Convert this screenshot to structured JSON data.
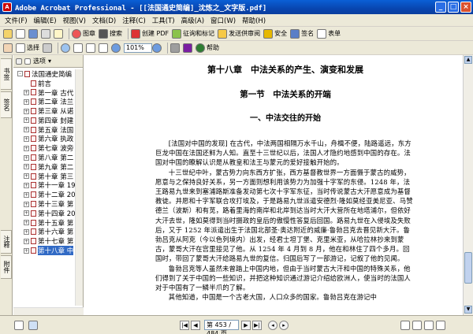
{
  "window": {
    "title": "Adobe Acrobat Professional - [[法国通史简编]_沈炼之_文字版.pdf]",
    "minimize": "_",
    "maximize": "□",
    "close": "×"
  },
  "menu": [
    "文件(F)",
    "编辑(E)",
    "视图(V)",
    "文档(D)",
    "注释(C)",
    "工具(T)",
    "高级(A)",
    "窗口(W)",
    "帮助(H)"
  ],
  "toolbar1": {
    "search_label": "图章",
    "find_label": "搜索",
    "create_pdf": "创建 PDF",
    "review": "征询和标记",
    "send": "发送供审阅",
    "secure": "安全",
    "sign": "签名",
    "forms": "表单"
  },
  "toolbar2": {
    "select_label": "选择",
    "zoom_value": "101%",
    "help_label": "帮助"
  },
  "vtabs": [
    "书签",
    "签名",
    "注释",
    "附件"
  ],
  "bookmarks": {
    "header_label": "选项",
    "items": [
      {
        "label": "法国通史简编",
        "expand": "-",
        "selected": false,
        "indent": 0
      },
      {
        "label": "前言",
        "expand": "",
        "selected": false,
        "indent": 1
      },
      {
        "label": "第一章 古代",
        "expand": "+",
        "selected": false,
        "indent": 1
      },
      {
        "label": "第二章 法兰",
        "expand": "+",
        "selected": false,
        "indent": 1
      },
      {
        "label": "第三章 从诺",
        "expand": "+",
        "selected": false,
        "indent": 1
      },
      {
        "label": "第四章 封建",
        "expand": "+",
        "selected": false,
        "indent": 1
      },
      {
        "label": "第五章 法国",
        "expand": "+",
        "selected": false,
        "indent": 1
      },
      {
        "label": "第六章 执政",
        "expand": "+",
        "selected": false,
        "indent": 1
      },
      {
        "label": "第七章 波旁",
        "expand": "+",
        "selected": false,
        "indent": 1
      },
      {
        "label": "第八章 第二",
        "expand": "+",
        "selected": false,
        "indent": 1
      },
      {
        "label": "第九章 第二",
        "expand": "+",
        "selected": false,
        "indent": 1
      },
      {
        "label": "第十章 第三",
        "expand": "+",
        "selected": false,
        "indent": 1
      },
      {
        "label": "第十一章 19",
        "expand": "+",
        "selected": false,
        "indent": 1
      },
      {
        "label": "第十二章 20",
        "expand": "+",
        "selected": false,
        "indent": 1
      },
      {
        "label": "第十三章 第",
        "expand": "+",
        "selected": false,
        "indent": 1
      },
      {
        "label": "第十四章 20",
        "expand": "+",
        "selected": false,
        "indent": 1
      },
      {
        "label": "第十五章 第",
        "expand": "+",
        "selected": false,
        "indent": 1
      },
      {
        "label": "第十六章 第",
        "expand": "+",
        "selected": false,
        "indent": 1
      },
      {
        "label": "第十七章 第",
        "expand": "+",
        "selected": false,
        "indent": 1
      },
      {
        "label": "第十八章 中",
        "expand": "+",
        "selected": true,
        "indent": 1
      }
    ]
  },
  "document": {
    "chapter": "第十八章　中法关系的产生、演变和发展",
    "section": "第一节　中法关系的开端",
    "subsection": "一、中法交往的开始",
    "paragraphs": [
      "[法国对中国的发现] 在古代，中法两国相隔万水千山，舟楫不便，陆路遥远，东方巨龙中国在法国还鲜为人知。直至十三世纪以后，法国人才隐约地感到中国的存在。法国对中国的瞭解认识是从教皇和法王与蒙元的爱好接触开始的。",
      "十三世纪中叶，蒙古势力向东西方扩张，西方基督教世界一方面慑于蒙古的威势，愿意与之保持良好关系，另一方面则想利用该势力为加强十字军的东侵。1248 年，法王路易九世来到塞浦路斯准备发动第七次十字军东征，当时传说蒙古大汗愿意成为基督教徒。并愿和十字军联合攻打埃及，于是路易九世派遣安德烈·隆如莫经亚美尼亚、马赞德兰（波斯）和有苋，路着里海的南岸和北岸到达当时大汗大营所在地塔浦尔，但依好大汗去世，隆如莫得到当时摄政的皇后的傲慢性答复后回国。路易九世在入侵埃及失败后，又于 1252 年派遣出生于法国北部圣·奥达附近的威廉·鲁勃吕克去晋见新大汗。鲁勃吕克从阿克（今以色列境内）出发，经君士坦丁堡、克里米亚，从哈拉林抄来到蒙古，蒙哥大汗在宫里接见了他。从 1254 年 4 月到 8 月，他在和林住了四个多月。回国时，带回了蒙哥大汗给路易九世的复信。归国后写了一部游记，记叙了他的见闻。",
      "鲁勃吕克等人虽然未曾踏上中国内地，但由于当时蒙古大汗和中国的特殊关系，他们得到了关于中国的一些知识，并把这种知识通过游记介绍给欧洲人，使当时的法国人对于中国有了一鳞半爪的了解。",
      "其他知道，中国是一个古老大国，人口众多的国家。鲁勃吕克在游记中"
    ]
  },
  "status": {
    "page_display": "第 453 / 484 页"
  }
}
